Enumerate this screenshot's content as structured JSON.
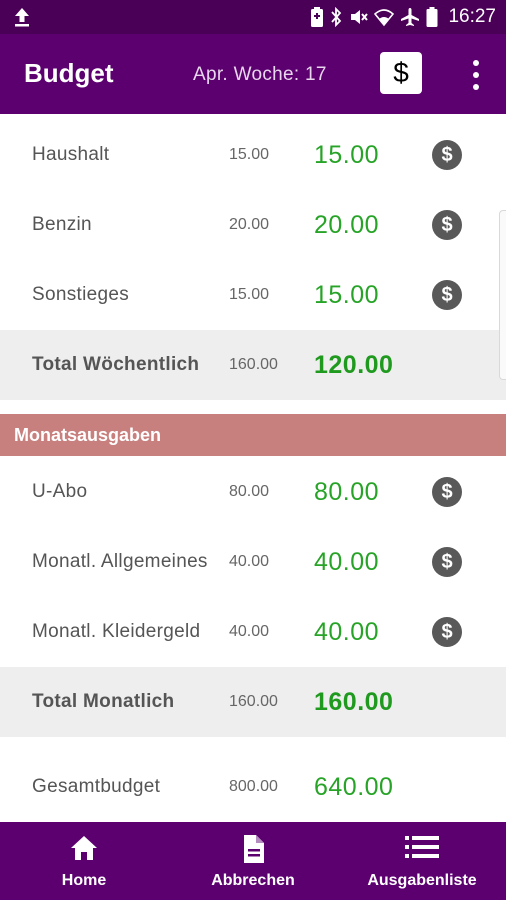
{
  "status": {
    "time": "16:27",
    "icons": [
      "upload-icon",
      "battery-saver-icon",
      "bluetooth-icon",
      "mute-icon",
      "wifi-icon",
      "airplane-icon",
      "battery-icon"
    ]
  },
  "appbar": {
    "title": "Budget",
    "subtitle": "Apr.  Woche: 17",
    "dollar_button": "$"
  },
  "weekly": {
    "rows": [
      {
        "label": "Haushalt",
        "budget": "15.00",
        "value": "15.00"
      },
      {
        "label": "Benzin",
        "budget": "20.00",
        "value": "20.00"
      },
      {
        "label": "Sonstieges",
        "budget": "15.00",
        "value": "15.00"
      }
    ],
    "total": {
      "label": "Total Wöchentlich",
      "budget": "160.00",
      "value": "120.00"
    }
  },
  "monthly": {
    "header": "Monatsausgaben",
    "rows": [
      {
        "label": "U-Abo",
        "budget": "80.00",
        "value": "80.00"
      },
      {
        "label": "Monatl. Allgemeines",
        "budget": "40.00",
        "value": "40.00"
      },
      {
        "label": "Monatl. Kleidergeld",
        "budget": "40.00",
        "value": "40.00"
      }
    ],
    "total": {
      "label": "Total Monatlich",
      "budget": "160.00",
      "value": "160.00"
    }
  },
  "overall": {
    "label": "Gesamtbudget",
    "budget": "800.00",
    "value": "640.00"
  },
  "coin_symbol": "$",
  "nav": {
    "home": "Home",
    "cancel": "Abbrechen",
    "expenses": "Ausgabenliste"
  },
  "colors": {
    "statusbar": "#4a0057",
    "primary": "#5c0070",
    "amount_green": "#27a327",
    "section_header": "#c8807f",
    "total_row": "#eeeeee"
  }
}
